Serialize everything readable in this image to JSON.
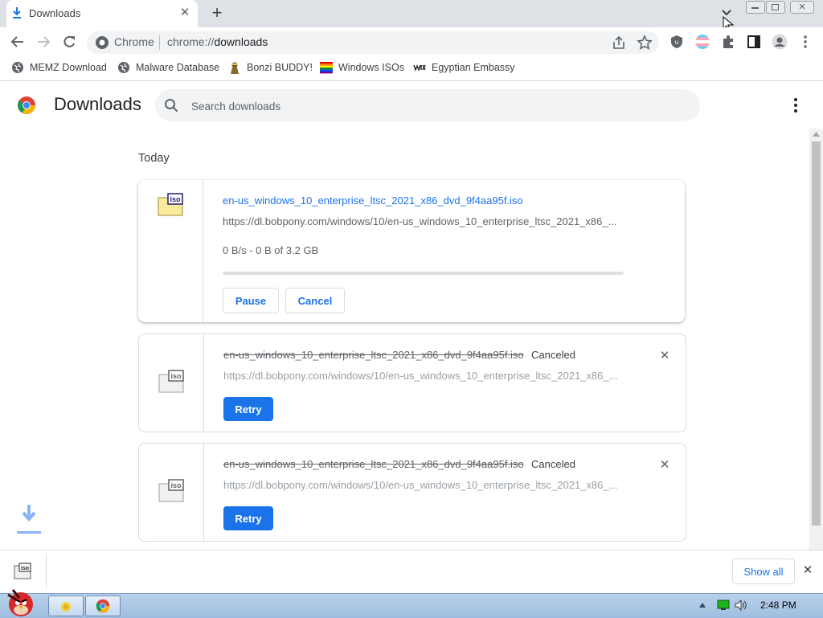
{
  "window": {
    "tab_title": "Downloads",
    "tab_close": "✕",
    "new_tab": "+",
    "colors": {
      "frame": "#dee1e6",
      "accent": "#1a73e8"
    }
  },
  "toolbar": {
    "site_label": "Chrome",
    "url_scheme": "chrome://",
    "url_path": "downloads",
    "icons": [
      "back-icon",
      "forward-icon",
      "reload-icon",
      "site-info-icon",
      "share-icon",
      "bookmark-star-icon",
      "ublock-icon",
      "trans-flag-icon",
      "extensions-icon",
      "side-panel-icon",
      "profile-icon",
      "menu-icon"
    ]
  },
  "bookmarks": [
    {
      "label": "MEMZ Download",
      "icon": "globe-icon"
    },
    {
      "label": "Malware Database",
      "icon": "globe-icon"
    },
    {
      "label": "Bonzi BUDDY!",
      "icon": "bonzi-icon"
    },
    {
      "label": "Windows ISOs",
      "icon": "rainbow-flag-icon"
    },
    {
      "label": "Egyptian Embassy",
      "icon": "wix-icon"
    }
  ],
  "header": {
    "title": "Downloads",
    "search_placeholder": "Search downloads"
  },
  "date_group": "Today",
  "downloads": [
    {
      "filename": "en-us_windows_10_enterprise_ltsc_2021_x86_dvd_9f4aa95f.iso",
      "url": "https://dl.bobpony.com/windows/10/en-us_windows_10_enterprise_ltsc_2021_x86_...",
      "progress_text": "0 B/s - 0 B of 3.2 GB",
      "progress": 0,
      "pause_label": "Pause",
      "cancel_label": "Cancel"
    },
    {
      "filename": "en-us_windows_10_enterprise_ltsc_2021_x86_dvd_9f4aa95f.iso",
      "status": "Canceled",
      "url": "https://dl.bobpony.com/windows/10/en-us_windows_10_enterprise_ltsc_2021_x86_...",
      "retry_label": "Retry",
      "remove": "✕"
    },
    {
      "filename": "en-us_windows_10_enterprise_ltsc_2021_x86_dvd_9f4aa95f.iso",
      "status": "Canceled",
      "url": "https://dl.bobpony.com/windows/10/en-us_windows_10_enterprise_ltsc_2021_x86_...",
      "retry_label": "Retry",
      "remove": "✕"
    }
  ],
  "iso_icon_text": "iso",
  "shelf": {
    "show_all": "Show all",
    "close": "✕"
  },
  "taskbar": {
    "time": "2:48 PM"
  }
}
